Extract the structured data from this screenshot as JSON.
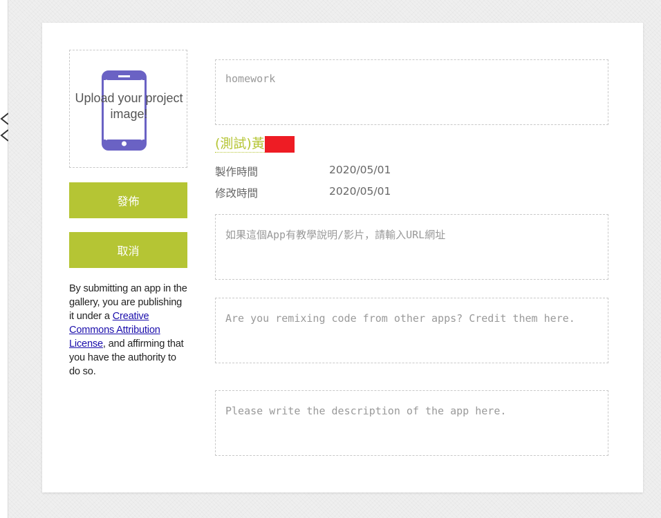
{
  "image_upload": {
    "label": "Upload your project image!",
    "icon": "tablet-icon",
    "icon_color": "#6a62c4"
  },
  "actions": {
    "publish_label": "發佈",
    "cancel_label": "取消",
    "button_color": "#b5c534"
  },
  "license": {
    "text_before": "By submitting an app in the gallery, you are publishing it under a ",
    "link_text": "Creative Commons Attribution License",
    "text_after": ", and affirming that you have the authority to do so."
  },
  "form": {
    "title_placeholder": "homework",
    "tutorial_placeholder": "如果這個App有教學說明/影片，請輸入URL網址",
    "credit_placeholder": "Are you remixing code from other apps? Credit them here.",
    "description_placeholder": "Please write the description of the app here."
  },
  "author": {
    "name": "(測試)黃"
  },
  "meta": {
    "created_label": "製作時間",
    "created_value": "2020/05/01",
    "modified_label": "修改時間",
    "modified_value": "2020/05/01"
  }
}
